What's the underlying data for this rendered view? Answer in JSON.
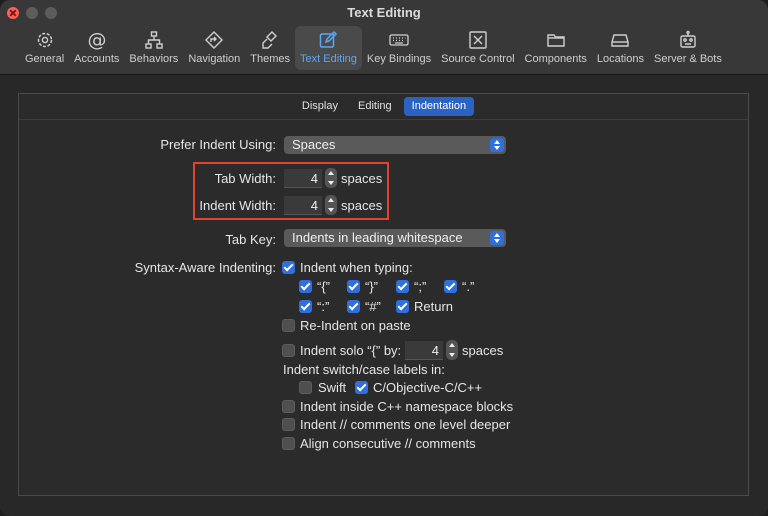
{
  "window": {
    "title": "Text Editing"
  },
  "toolbar": {
    "items": [
      {
        "label": "General",
        "icon": "gear-icon"
      },
      {
        "label": "Accounts",
        "icon": "at-icon"
      },
      {
        "label": "Behaviors",
        "icon": "hierarchy-icon"
      },
      {
        "label": "Navigation",
        "icon": "diamond-arrow-icon"
      },
      {
        "label": "Themes",
        "icon": "brush-icon"
      },
      {
        "label": "Text Editing",
        "icon": "edit-icon",
        "active": true
      },
      {
        "label": "Key Bindings",
        "icon": "keyboard-icon"
      },
      {
        "label": "Source Control",
        "icon": "source-control-icon"
      },
      {
        "label": "Components",
        "icon": "folder-icon"
      },
      {
        "label": "Locations",
        "icon": "drive-icon"
      },
      {
        "label": "Server & Bots",
        "icon": "robot-icon"
      }
    ]
  },
  "tabs": [
    "Display",
    "Editing",
    "Indentation"
  ],
  "active_tab": "Indentation",
  "form": {
    "prefer_indent_label": "Prefer Indent Using:",
    "prefer_indent_value": "Spaces",
    "tab_width_label": "Tab Width:",
    "tab_width_value": "4",
    "tab_width_unit": "spaces",
    "indent_width_label": "Indent Width:",
    "indent_width_value": "4",
    "indent_width_unit": "spaces",
    "tab_key_label": "Tab Key:",
    "tab_key_value": "Indents in leading whitespace",
    "syntax_label": "Syntax-Aware Indenting:",
    "indent_when_typing": "Indent when typing:",
    "chars": [
      "“{”",
      "“}”",
      "“;”",
      "“.”",
      "“:”",
      "“#”",
      "Return"
    ],
    "reindent_paste": "Re-Indent on paste",
    "indent_solo_label": "Indent solo “{” by:",
    "indent_solo_value": "4",
    "indent_solo_unit": "spaces",
    "switch_case_label": "Indent switch/case labels in:",
    "swift": "Swift",
    "objc": "C/Objective-C/C++",
    "cpp_namespace": "Indent inside C++ namespace blocks",
    "comments_deeper": "Indent // comments one level deeper",
    "align_comments": "Align consecutive // comments"
  },
  "colors": {
    "accent": "#2f6fde",
    "highlight_box": "#e2432e",
    "active_tab_text": "#5aa8f5"
  }
}
